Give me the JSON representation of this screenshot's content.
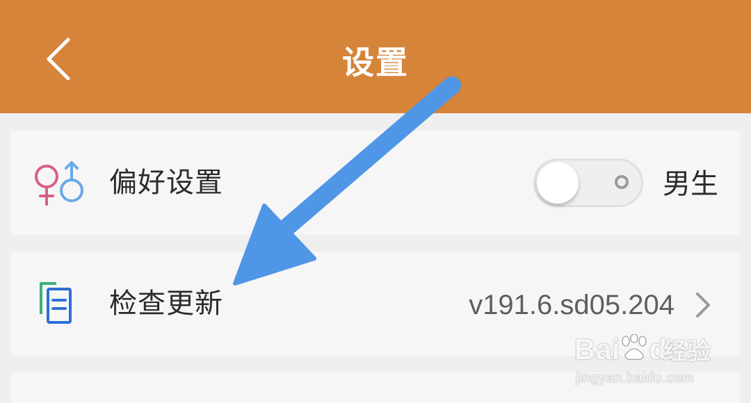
{
  "header": {
    "title": "设置",
    "back_icon": "chevron-left-icon",
    "background_color": "#d6843a"
  },
  "settings": {
    "items": [
      {
        "label": "偏好设置",
        "icon": "gender-symbols-icon",
        "toggle_on": false,
        "value": "男生"
      },
      {
        "label": "检查更新",
        "icon": "document-copy-icon",
        "value": "v191.6.sd05.204",
        "trailing_icon": "chevron-right-icon"
      }
    ]
  },
  "annotation": {
    "icon": "blue-arrow-icon",
    "color": "#5096e6"
  },
  "watermark": {
    "brand": "Bai",
    "brand_suffix": "du",
    "cn": "经验",
    "url": "jingyan.baidu.com"
  }
}
